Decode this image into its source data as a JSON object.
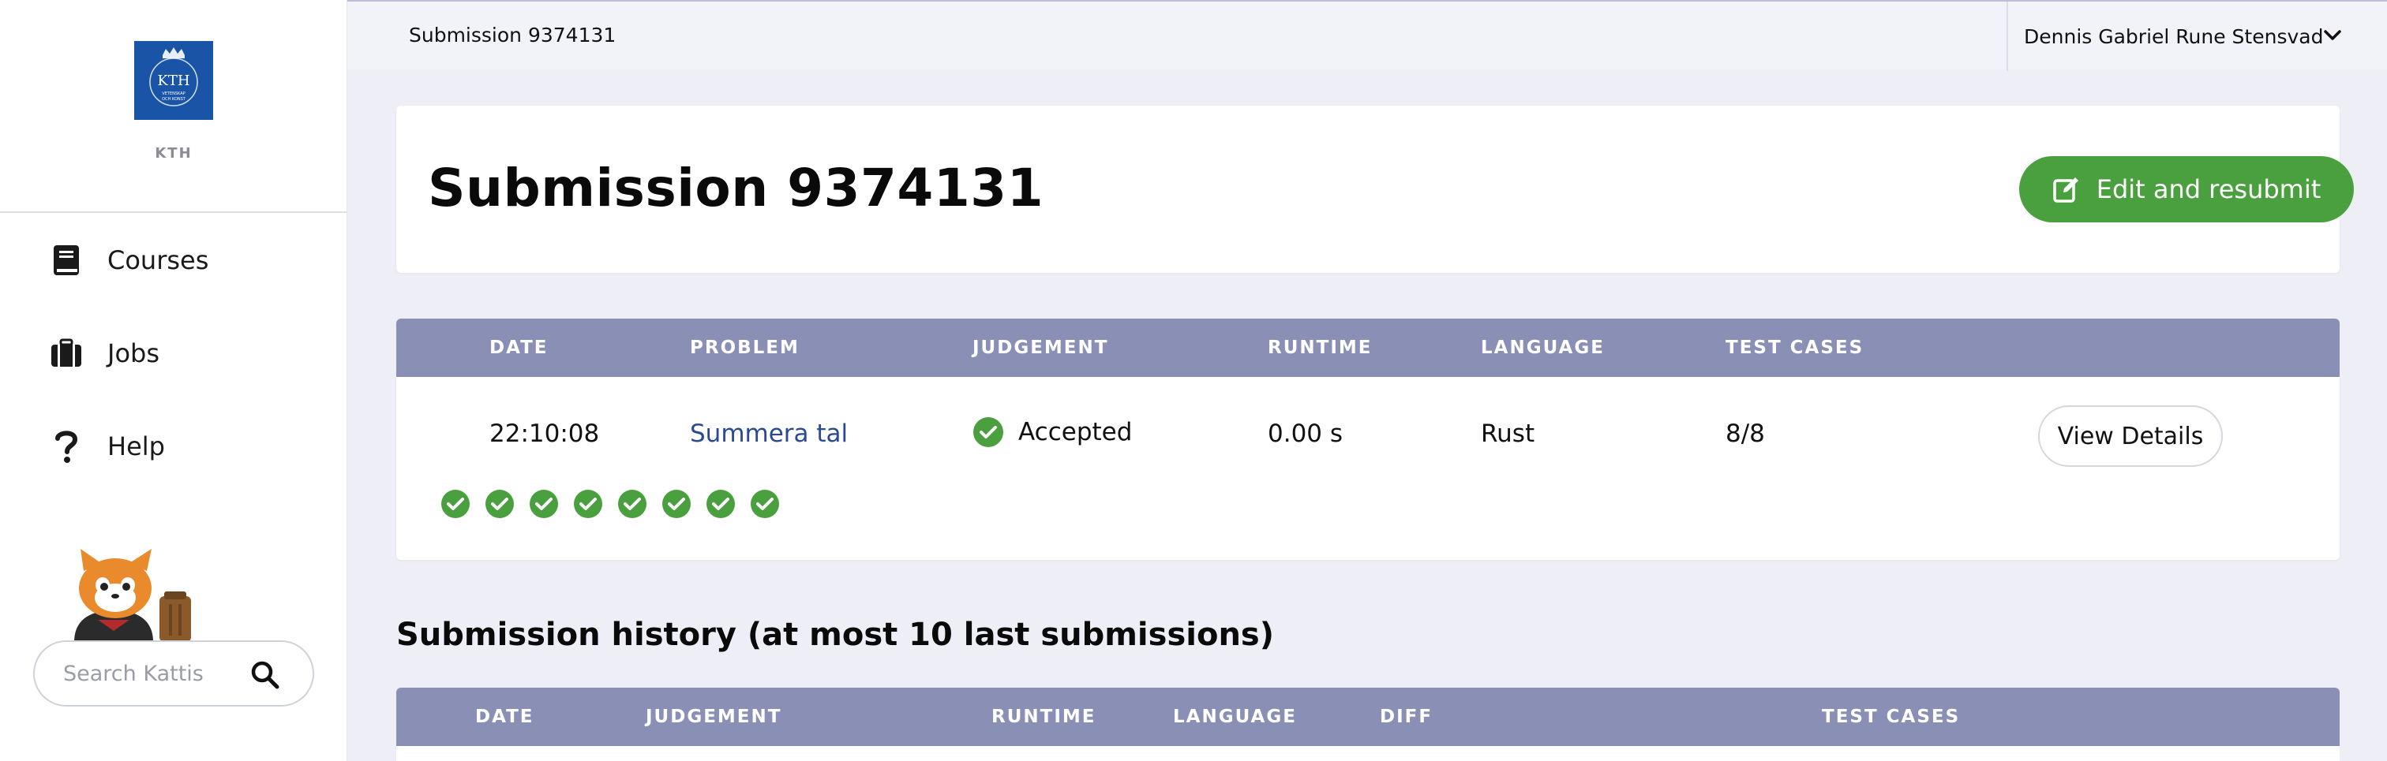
{
  "sidebar": {
    "logo_caption": "KTH",
    "logo_text": "KTH",
    "logo_small_1": "VETENSKAP",
    "logo_small_2": "OCH KONST",
    "items": [
      {
        "label": "Courses",
        "icon": "book-icon"
      },
      {
        "label": "Jobs",
        "icon": "briefcase-icon"
      },
      {
        "label": "Help",
        "icon": "question-icon"
      }
    ],
    "search_placeholder": "Search Kattis"
  },
  "topbar": {
    "breadcrumb": "Submission 9374131",
    "user_name": "Dennis Gabriel Rune Stensvad"
  },
  "header": {
    "title": "Submission 9374131",
    "resubmit_label": "Edit and resubmit"
  },
  "submission_table": {
    "columns": [
      "DATE",
      "PROBLEM",
      "JUDGEMENT",
      "RUNTIME",
      "LANGUAGE",
      "TEST CASES"
    ],
    "row": {
      "date": "22:10:08",
      "problem": "Summera tal",
      "judgement": "Accepted",
      "runtime": "0.00 s",
      "language": "Rust",
      "test_cases": "8/8",
      "view_details_label": "View Details",
      "test_case_results": [
        "pass",
        "pass",
        "pass",
        "pass",
        "pass",
        "pass",
        "pass",
        "pass"
      ]
    }
  },
  "history": {
    "title": "Submission history (at most 10 last submissions)",
    "columns": [
      "DATE",
      "JUDGEMENT",
      "RUNTIME",
      "LANGUAGE",
      "DIFF",
      "TEST CASES"
    ]
  },
  "colors": {
    "accent_green": "#4aa03f",
    "table_header": "#8a90b5",
    "link_blue": "#2b4a8f",
    "kth_blue": "#1954a6"
  }
}
